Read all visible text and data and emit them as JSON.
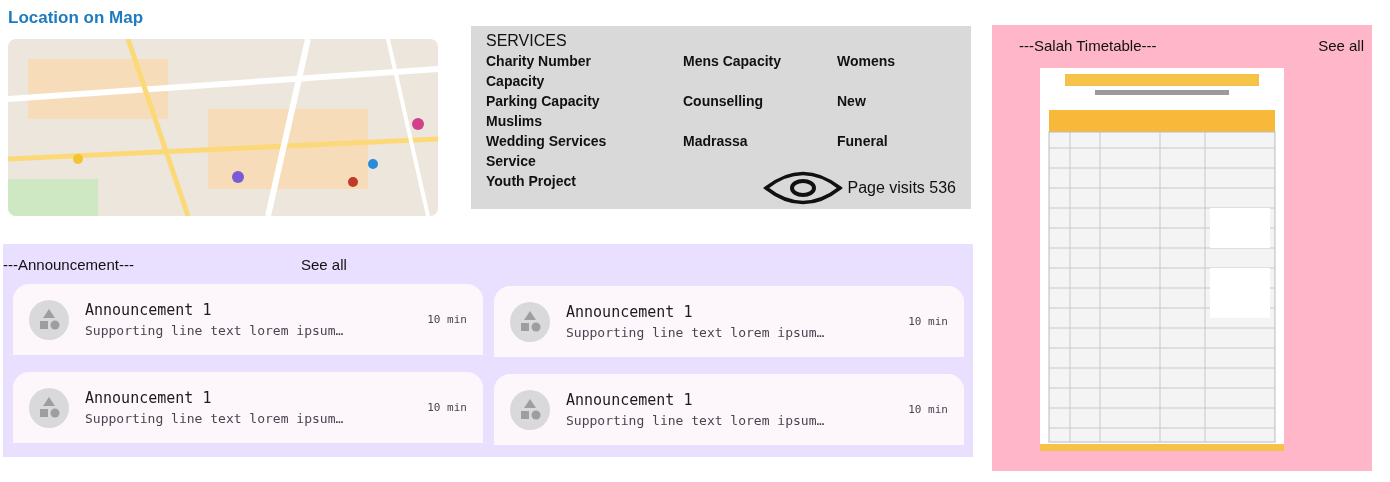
{
  "map_section": {
    "title": "Location on Map"
  },
  "services": {
    "title": "SERVICES",
    "items": [
      "Charity Number",
      "Mens Capacity",
      "Womens Capacity",
      "Parking Capacity",
      "Counselling",
      "New Muslims",
      "Wedding Services",
      "Madrassa",
      "Funeral Service",
      "Youth Project"
    ],
    "page_visits": "Page visits 536"
  },
  "announcements": {
    "title": "---Announcement---",
    "see_all": "See all",
    "items": [
      {
        "title": "Announcement 1",
        "text": "Supporting line text lorem ipsum…",
        "time": "10 min"
      },
      {
        "title": "Announcement 1",
        "text": "Supporting line text lorem ipsum…",
        "time": "10 min"
      },
      {
        "title": "Announcement 1",
        "text": "Supporting line text lorem ipsum…",
        "time": "10 min"
      },
      {
        "title": "Announcement 1",
        "text": "Supporting line text lorem ipsum…",
        "time": "10 min"
      }
    ]
  },
  "timetable": {
    "title": "---Salah Timetable---",
    "see_all": "See all"
  }
}
